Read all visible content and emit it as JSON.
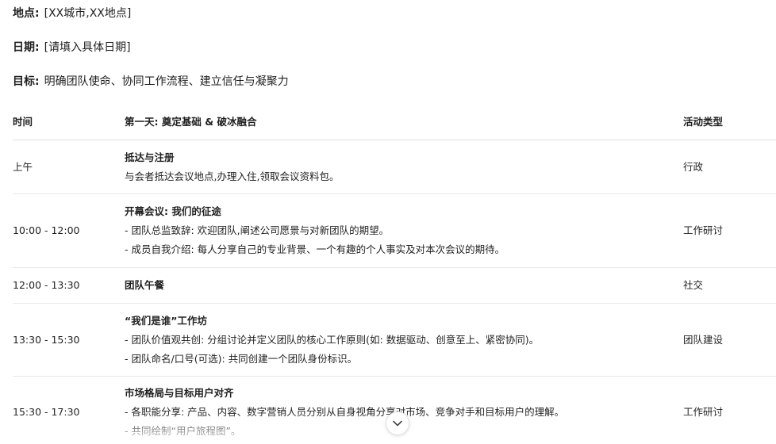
{
  "meta": {
    "location_label": "地点:",
    "location_value": "[XX城市,XX地点]",
    "date_label": "日期:",
    "date_value": "[请填入具体日期]",
    "goal_label": "目标:",
    "goal_value": "明确团队使命、协同工作流程、建立信任与凝聚力"
  },
  "table": {
    "headers": {
      "time": "时间",
      "content": "第一天: 奠定基础 & 破冰融合",
      "type": "活动类型"
    },
    "rows": [
      {
        "time": "上午",
        "title": "抵达与注册",
        "lines": [
          "与会者抵达会议地点,办理入住,领取会议资料包。"
        ],
        "type": "行政"
      },
      {
        "time": "10:00 - 12:00",
        "title": "开幕会议: 我们的征途",
        "lines": [
          "- 团队总监致辞: 欢迎团队,阐述公司愿景与对新团队的期望。",
          "- 成员自我介绍: 每人分享自己的专业背景、一个有趣的个人事实及对本次会议的期待。"
        ],
        "type": "工作研讨"
      },
      {
        "time": "12:00 - 13:30",
        "title": "团队午餐",
        "lines": [],
        "type": "社交"
      },
      {
        "time": "13:30 - 15:30",
        "title": "“我们是谁”工作坊",
        "lines": [
          "- 团队价值观共创: 分组讨论并定义团队的核心工作原则(如: 数据驱动、创意至上、紧密协同)。",
          "- 团队命名/口号(可选): 共同创建一个团队身份标识。"
        ],
        "type": "团队建设"
      },
      {
        "time": "15:30 - 17:30",
        "title": "市场格局与目标用户对齐",
        "lines": [
          "- 各职能分享: 产品、内容、数字营销人员分别从自身视角分享对市场、竞争对手和目标用户的理解。",
          "- 共同绘制“用户旅程图”。"
        ],
        "type": "工作研讨"
      }
    ]
  },
  "scroll_button": {
    "icon": "chevron-down-icon"
  }
}
